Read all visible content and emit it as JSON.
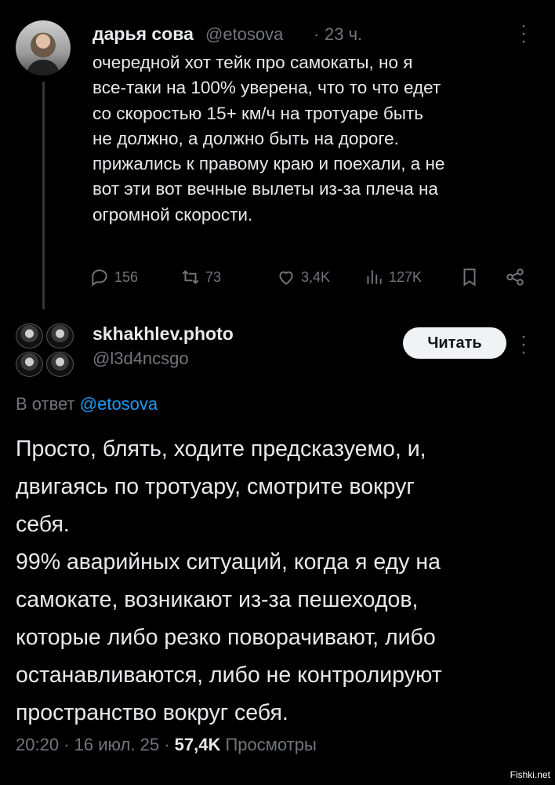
{
  "tweet1": {
    "author_name": "дарья сова",
    "author_handle": "@etosova",
    "separator": "·",
    "time": "23 ч.",
    "more_icon": "more-vertical-icon",
    "lines": [
      "очередной хот тейк про самокаты, но я",
      "все-таки на 100% уверена, что то что едет",
      "со скоростью 15+ км/ч на тротуаре быть",
      "не должно, а должно быть на дороге.",
      "прижались к правому краю и поехали, а не",
      "вот эти вот вечные вылеты из-за плеча на",
      "огромной скорости."
    ],
    "actions": {
      "replies": "156",
      "retweets": "73",
      "likes": "3,4K",
      "views": "127K"
    }
  },
  "tweet2": {
    "author_name": "skhakhlev.photo",
    "author_handle": "@l3d4ncsgo",
    "follow_label": "Читать",
    "reply_prefix": "В ответ",
    "reply_mention": "@etosova",
    "lines": [
      "Просто, блять, ходите предсказуемо, и,",
      "двигаясь по тротуару, смотрите вокруг",
      "себя.",
      "99% аварийных ситуаций, когда я еду на",
      "самокате, возникают из-за пешеходов,",
      "которые либо резко поворачивают, либо",
      "останавливаются, либо не контролируют",
      "пространство вокруг себя."
    ],
    "time": "20:20",
    "date": "16 июл. 25",
    "separator": "·",
    "views": "57,4K",
    "views_label": "Просмотры"
  },
  "watermark": "Fishki.net",
  "colors": {
    "background": "#000000",
    "text": "#e7e9ea",
    "secondary": "#71767b",
    "link": "#1d9bf0",
    "button_bg": "#eff3f4"
  }
}
